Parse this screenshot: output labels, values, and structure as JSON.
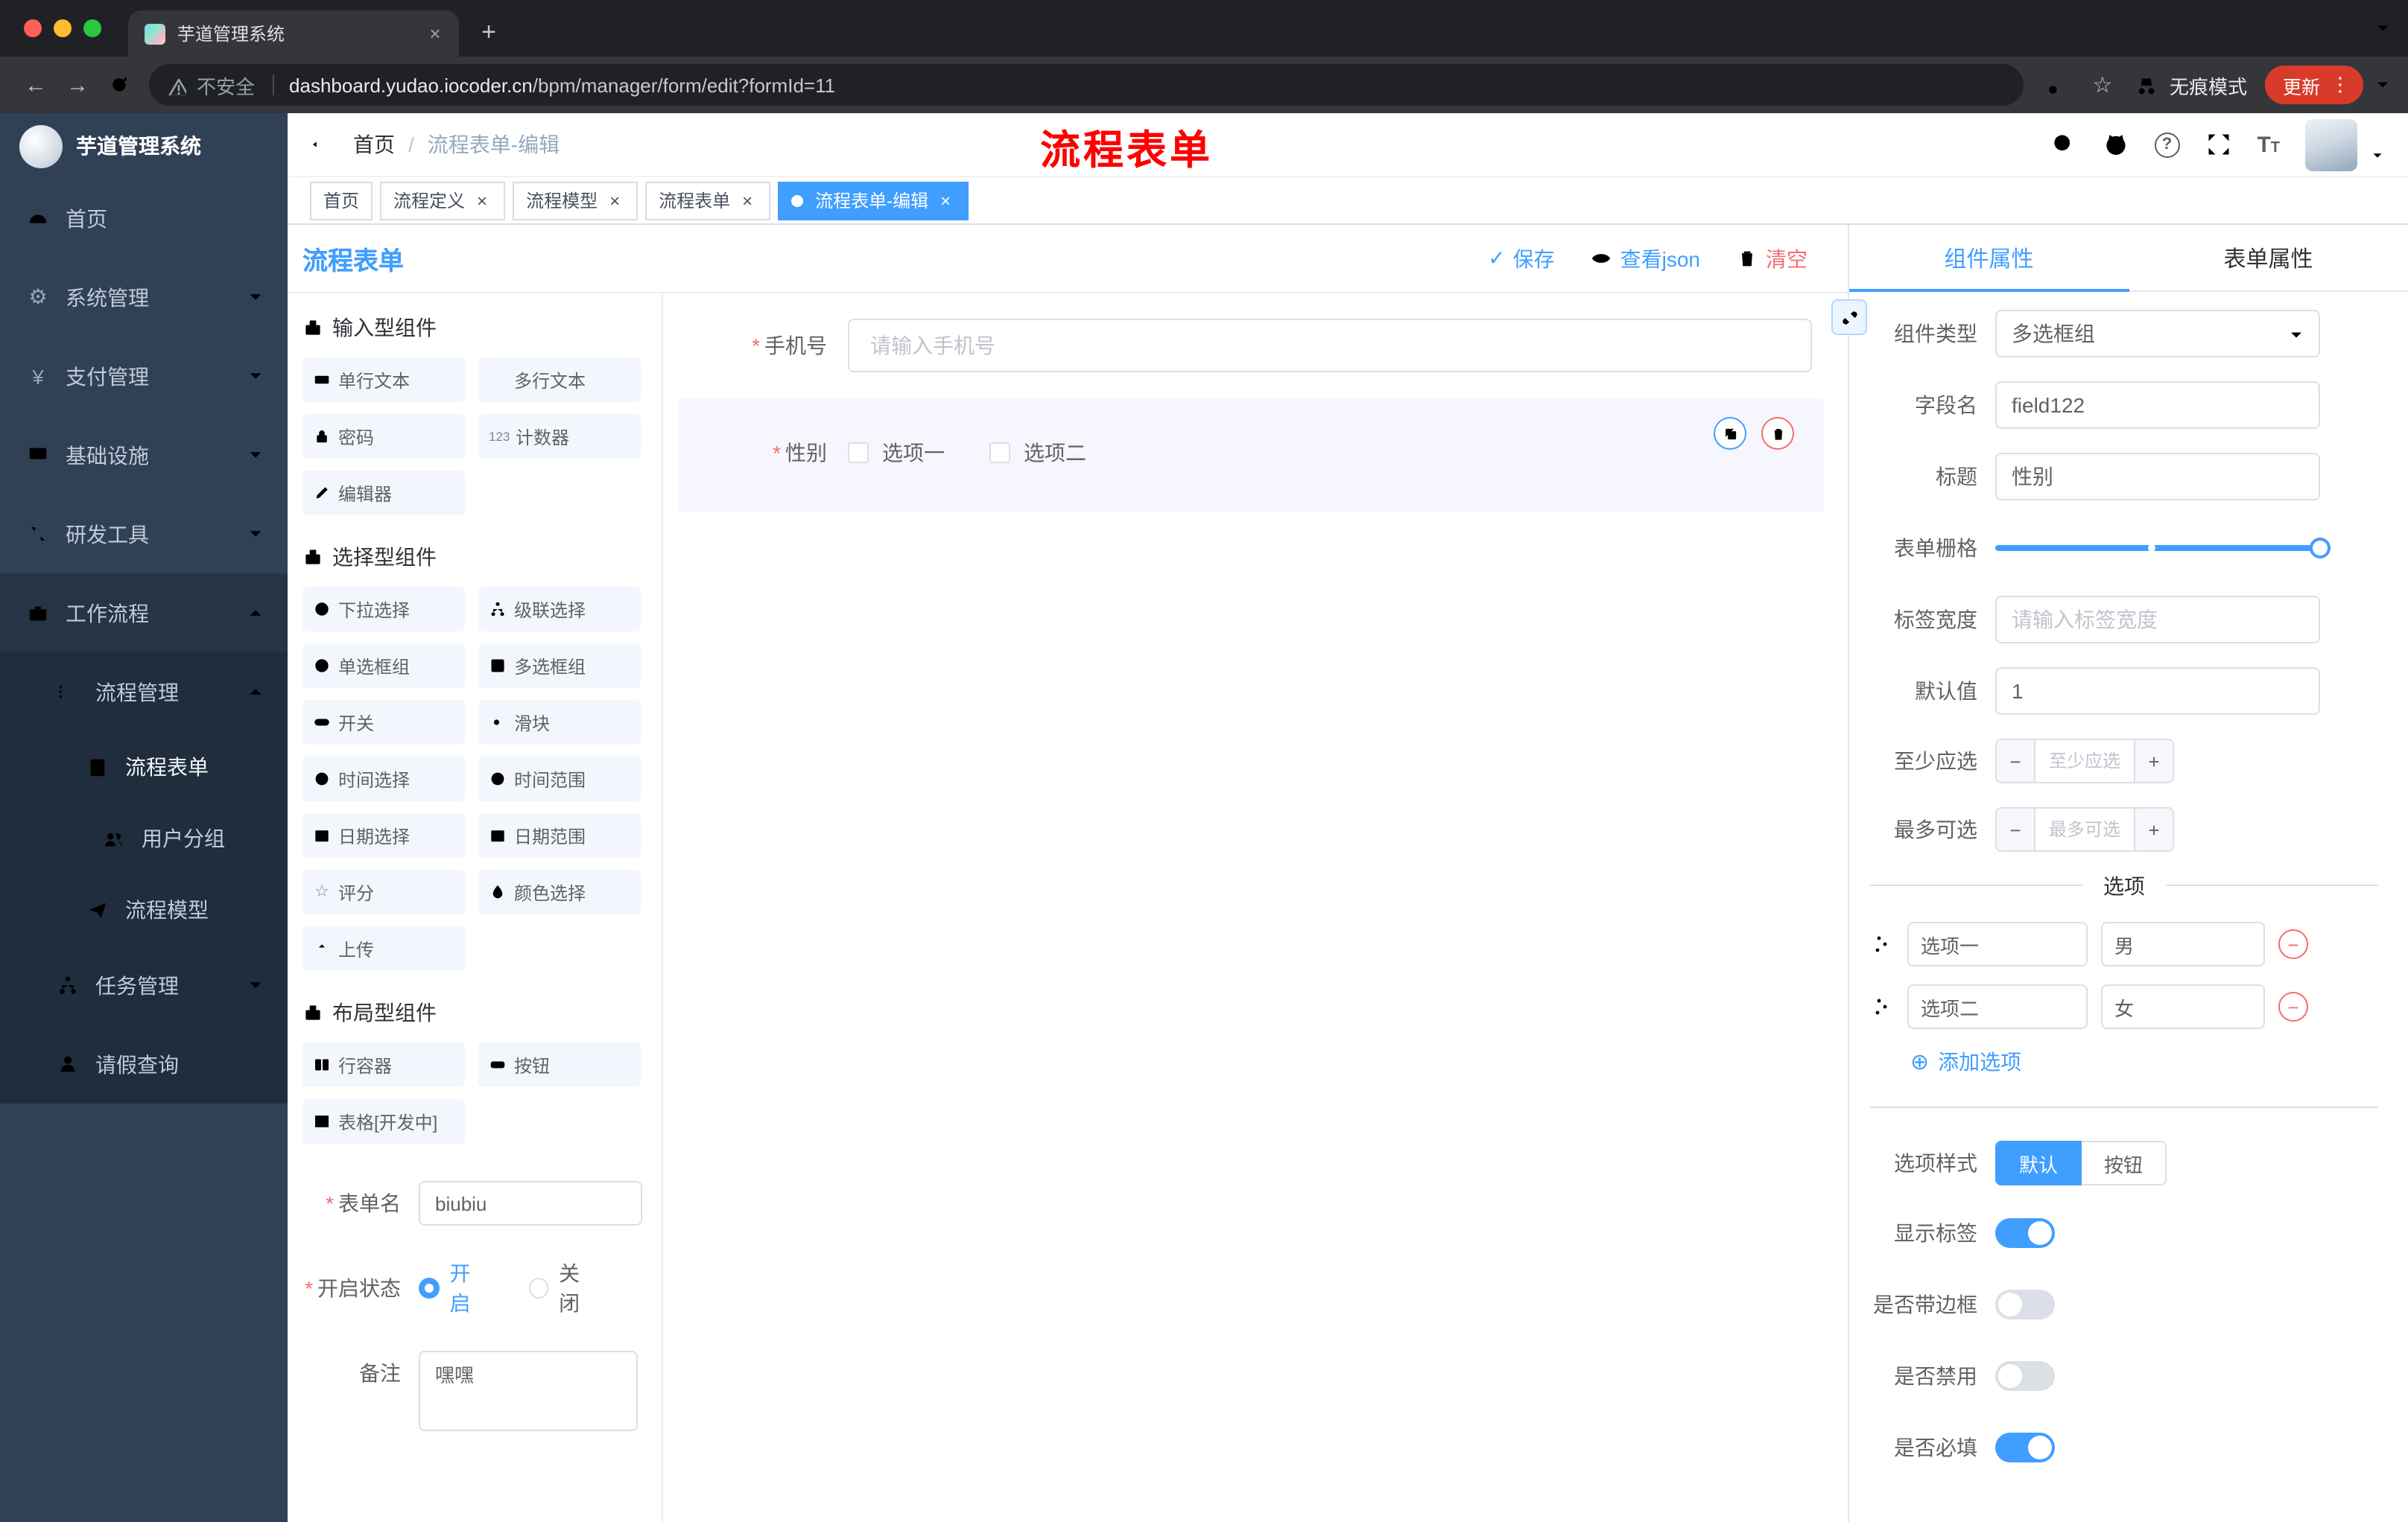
{
  "colors": {
    "accent": "#409eff",
    "danger": "#f56c6c",
    "annotation": "#ff0000",
    "sidebar_bg": "#304156",
    "submenu_bg": "#1f2d3d",
    "update_badge": "#d93b2a"
  },
  "icons": {
    "close": "×",
    "plus": "+",
    "minus": "−",
    "dots_vertical": "⋮",
    "check": "✓",
    "question": "?",
    "star": "☆",
    "yen": "¥",
    "gear": "⚙",
    "warning": "⚠",
    "counter": "123",
    "slash": "/",
    "asterisk": "*",
    "circle_plus": "⊕",
    "arrow_left": "←",
    "arrow_right": "→",
    "font_big": "T",
    "font_small": "T"
  },
  "browser": {
    "tab_title": "芋道管理系统",
    "security_label": "不安全",
    "url_domain": "dashboard.yudao.iocoder.cn",
    "url_path": "/bpm/manager/form/edit?formId=11",
    "incognito_label": "无痕模式",
    "update_label": "更新"
  },
  "sidebar": {
    "logo_title": "芋道管理系统",
    "items": [
      {
        "label": "首页"
      },
      {
        "label": "系统管理"
      },
      {
        "label": "支付管理"
      },
      {
        "label": "基础设施"
      },
      {
        "label": "研发工具"
      },
      {
        "label": "工作流程"
      }
    ],
    "process_mgmt": "流程管理",
    "process_children": [
      {
        "label": "流程表单"
      },
      {
        "label": "用户分组"
      },
      {
        "label": "流程模型"
      }
    ],
    "task_mgmt": "任务管理",
    "leave_query": "请假查询"
  },
  "header": {
    "breadcrumb_home": "首页",
    "breadcrumb_current": "流程表单-编辑",
    "annotation": "流程表单"
  },
  "tags": [
    "首页",
    "流程定义",
    "流程模型",
    "流程表单",
    "流程表单-编辑"
  ],
  "designer": {
    "title": "流程表单",
    "save": "保存",
    "view_json": "查看json",
    "clear": "清空",
    "groups": [
      {
        "title": "输入型组件",
        "items": [
          {
            "label": "单行文本",
            "icon": "single-line-text-icon"
          },
          {
            "label": "多行文本",
            "icon": "multi-line-text-icon"
          },
          {
            "label": "密码",
            "icon": "lock-icon"
          },
          {
            "label": "计数器",
            "icon": "counter-icon"
          },
          {
            "label": "编辑器",
            "icon": "editor-icon"
          }
        ]
      },
      {
        "title": "选择型组件",
        "items": [
          {
            "label": "下拉选择",
            "icon": "select-icon"
          },
          {
            "label": "级联选择",
            "icon": "cascader-icon"
          },
          {
            "label": "单选框组",
            "icon": "radio-icon"
          },
          {
            "label": "多选框组",
            "icon": "checkbox-icon"
          },
          {
            "label": "开关",
            "icon": "switch-icon"
          },
          {
            "label": "滑块",
            "icon": "slider-icon"
          },
          {
            "label": "时间选择",
            "icon": "time-icon"
          },
          {
            "label": "时间范围",
            "icon": "time-range-icon"
          },
          {
            "label": "日期选择",
            "icon": "date-icon"
          },
          {
            "label": "日期范围",
            "icon": "date-range-icon"
          },
          {
            "label": "评分",
            "icon": "rate-icon"
          },
          {
            "label": "颜色选择",
            "icon": "color-icon"
          },
          {
            "label": "上传",
            "icon": "upload-icon"
          }
        ]
      },
      {
        "title": "布局型组件",
        "items": [
          {
            "label": "行容器",
            "icon": "row-icon"
          },
          {
            "label": "按钮",
            "icon": "button-icon"
          },
          {
            "label": "表格[开发中]",
            "icon": "table-icon"
          }
        ]
      }
    ],
    "meta": {
      "name_label": "表单名",
      "name_value": "biubiu",
      "status_label": "开启状态",
      "status_on": "开启",
      "status_off": "关闭",
      "status_selected": "开启",
      "remark_label": "备注",
      "remark_value": "嘿嘿"
    },
    "canvas": {
      "phone_label": "手机号",
      "phone_placeholder": "请输入手机号",
      "gender_label": "性别",
      "gender_opt1": "选项一",
      "gender_opt2": "选项二"
    }
  },
  "props": {
    "tab_component": "组件属性",
    "tab_form": "表单属性",
    "type_label": "组件类型",
    "type_value": "多选框组",
    "field_label": "字段名",
    "field_value": "field122",
    "title_label": "标题",
    "title_value": "性别",
    "grid_label": "表单栅格",
    "width_label": "标签宽度",
    "width_placeholder": "请输入标签宽度",
    "default_label": "默认值",
    "default_value": "1",
    "min_label": "至少应选",
    "min_placeholder": "至少应选",
    "max_label": "最多可选",
    "max_placeholder": "最多可选",
    "options_title": "选项",
    "options": [
      {
        "label": "选项一",
        "value": "男"
      },
      {
        "label": "选项二",
        "value": "女"
      }
    ],
    "add_option": "添加选项",
    "style_label": "选项样式",
    "style_default": "默认",
    "style_button": "按钮",
    "style_selected": "默认",
    "show_label": "显示标签",
    "show_label_on": true,
    "border_label": "是否带边框",
    "border_on": false,
    "disabled_label": "是否禁用",
    "disabled_on": false,
    "required_label": "是否必填",
    "required_on": true
  }
}
